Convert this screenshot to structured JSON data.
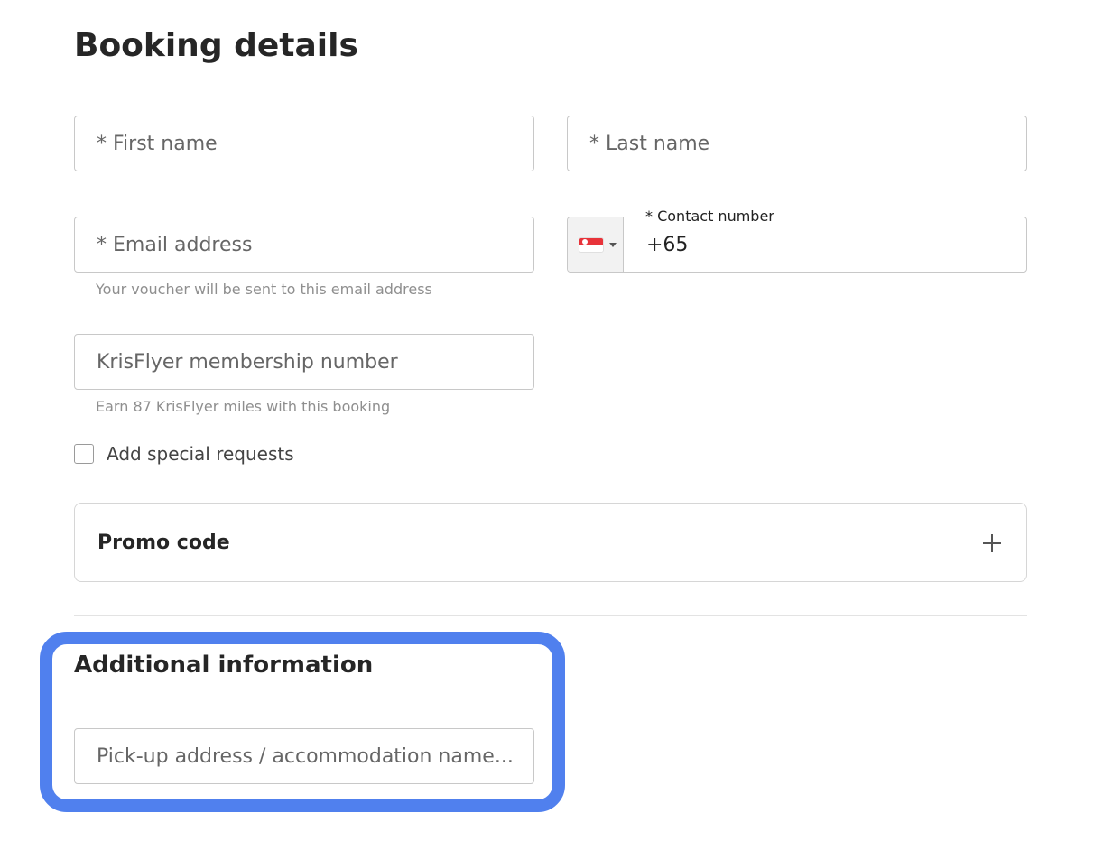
{
  "page": {
    "title": "Booking details"
  },
  "form": {
    "first_name": {
      "placeholder": "* First name",
      "value": ""
    },
    "last_name": {
      "placeholder": "* Last name",
      "value": ""
    },
    "email": {
      "placeholder": "* Email address",
      "value": "",
      "helper": "Your voucher will be sent to this email address"
    },
    "contact": {
      "label": "* Contact number",
      "value": "+65",
      "country_flag_icon": "singapore-flag-icon"
    },
    "krisflyer": {
      "placeholder": "KrisFlyer membership number",
      "value": "",
      "helper": "Earn 87 KrisFlyer miles with this booking"
    },
    "special_requests": {
      "label": "Add special requests",
      "checked": false
    }
  },
  "promo": {
    "title": "Promo code",
    "icon": "plus-icon"
  },
  "additional": {
    "title": "Additional information",
    "pickup": {
      "placeholder": "Pick-up address / accommodation name...",
      "value": ""
    }
  },
  "colors": {
    "highlight": "#5080ee",
    "flag_red": "#e8333a"
  }
}
